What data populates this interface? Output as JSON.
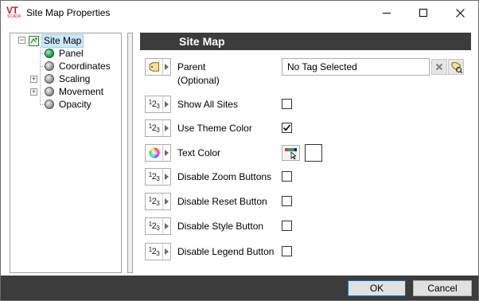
{
  "window": {
    "title": "Site Map Properties",
    "logo_text": "VT",
    "logo_sub": "SCADA"
  },
  "tree": {
    "root": "Site Map",
    "items": [
      {
        "label": "Panel",
        "icon": "green-ball-icon"
      },
      {
        "label": "Coordinates",
        "icon": "gray-ball-icon"
      },
      {
        "label": "Scaling",
        "icon": "gray-ball-icon",
        "expandable": true
      },
      {
        "label": "Movement",
        "icon": "gray-ball-icon",
        "expandable": true
      },
      {
        "label": "Opacity",
        "icon": "gray-ball-icon"
      }
    ]
  },
  "panel": {
    "header": "Site Map",
    "parent_label_1": "Parent",
    "parent_label_2": "(Optional)",
    "tag_value": "No Tag Selected",
    "props": [
      {
        "label": "Show All Sites",
        "checked": false
      },
      {
        "label": "Use Theme Color",
        "checked": true
      },
      {
        "label": "Text Color"
      },
      {
        "label": "Disable Zoom Buttons",
        "checked": false
      },
      {
        "label": "Disable Reset Button",
        "checked": false
      },
      {
        "label": "Disable Style Button",
        "checked": false
      },
      {
        "label": "Disable Legend Button",
        "checked": false
      }
    ],
    "text_color": "#ffffff"
  },
  "footer": {
    "ok": "OK",
    "cancel": "Cancel"
  }
}
